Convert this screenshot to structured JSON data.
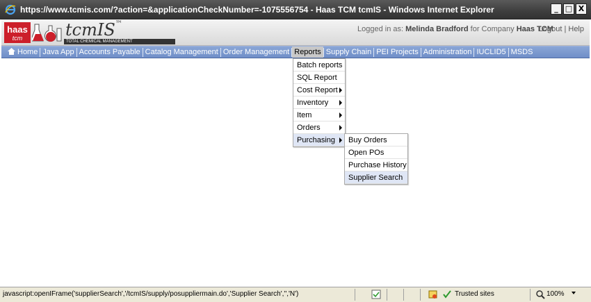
{
  "window": {
    "title": "https://www.tcmis.com/?action=&applicationCheckNumber=-1075556754 - Haas TCM tcmIS - Windows Internet Explorer",
    "minimize": "_",
    "maximize": "□",
    "close": "X"
  },
  "header": {
    "logo_haas": "haas",
    "logo_tcm": "tcm",
    "brand": "tcmIS",
    "brand_tm": "™",
    "tagline": "TOTAL CHEMICAL MANAGEMENT",
    "logged_prefix": "Logged in as:",
    "user": "Melinda Bradford",
    "company_prefix": "for Company",
    "company": "Haas TCM",
    "logout": "Logout",
    "help": "Help"
  },
  "nav": {
    "home": "Home",
    "java_app": "Java App",
    "accounts_payable": "Accounts Payable",
    "catalog_management": "Catalog Management",
    "order_management": "Order Management",
    "reports": "Reports",
    "supply_chain": "Supply Chain",
    "pei_projects": "PEI Projects",
    "administration": "Administration",
    "iuclid5": "IUCLID5",
    "msds": "MSDS"
  },
  "reports_menu": {
    "batch_reports": "Batch reports",
    "sql_report": "SQL Report",
    "cost_report": "Cost Report",
    "inventory": "Inventory",
    "item": "Item",
    "orders": "Orders",
    "purchasing": "Purchasing"
  },
  "purchasing_menu": {
    "buy_orders": "Buy Orders",
    "open_pos": "Open POs",
    "purchase_history": "Purchase History",
    "supplier_search": "Supplier Search"
  },
  "status": {
    "url": "javascript:openIFrame('supplierSearch','/tcmIS/supply/posuppliermain.do','Supplier Search','','N')",
    "zone": "Trusted sites",
    "zoom": "100%"
  },
  "colors": {
    "nav_bg": "#7b97cf",
    "logo_red": "#cc1f2a",
    "menu_highlight": "#dfe6f5"
  }
}
